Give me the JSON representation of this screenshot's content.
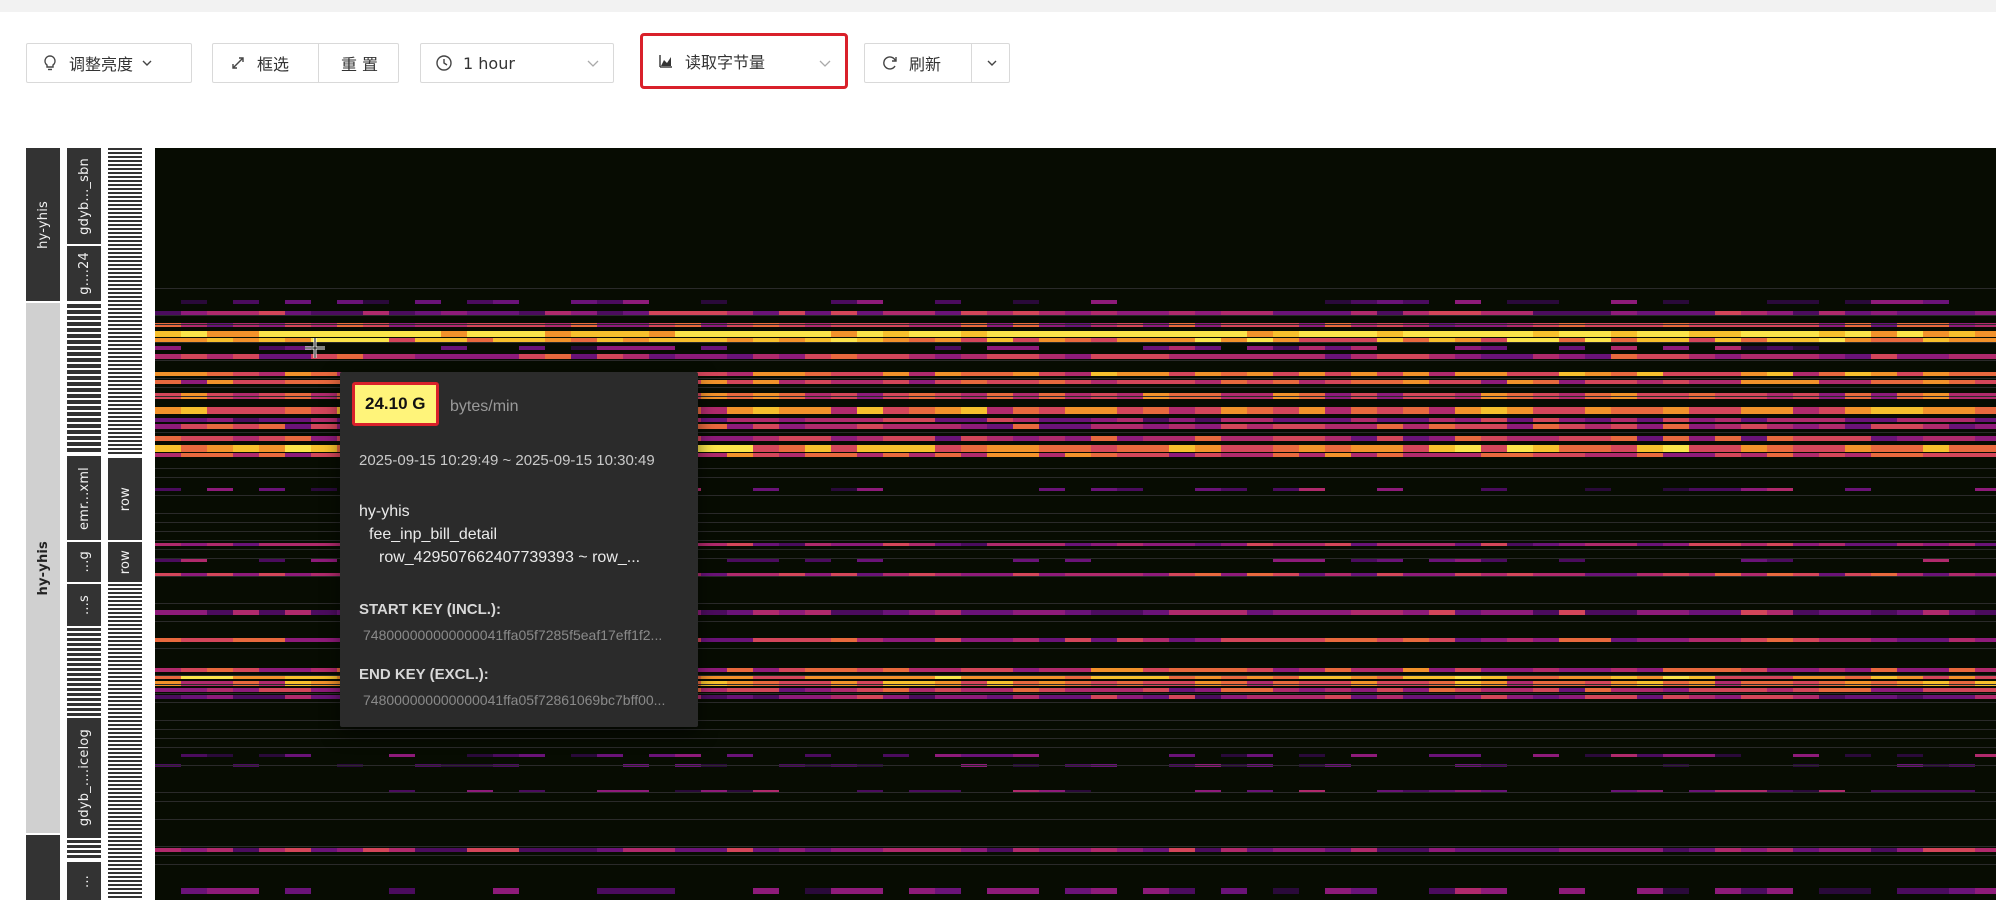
{
  "toolbar": {
    "brightness_label": "调整亮度",
    "select_label": "框选",
    "reset_label": "重 置",
    "time_range": "1 hour",
    "metric": "读取字节量",
    "refresh_label": "刷新"
  },
  "sidebar": {
    "col1": [
      "hy-yhis",
      "hy-yhis"
    ],
    "col2": [
      "gdyb..._sbn",
      "g....24",
      "emr...xml",
      "...g",
      "...s",
      "gdyb_....icelog",
      "..."
    ],
    "col3": [
      "row",
      "row"
    ]
  },
  "tooltip": {
    "value": "24.10 G",
    "unit": "bytes/min",
    "time": "2025-09-15 10:29:49 ~ 2025-09-15 10:30:49",
    "database": "hy-yhis",
    "table": "fee_inp_bill_detail",
    "range": "row_429507662407739393 ~ row_...",
    "start_key_label": "START KEY (INCL.):",
    "start_key": "748000000000000041ffa05f7285f5eaf17eff1f2...",
    "end_key_label": "END KEY (EXCL.):",
    "end_key": "748000000000000041ffa05f72861069bc7bff00..."
  },
  "colors": {
    "heatmap_bg": "#070c02",
    "highlight_border": "#d9202a",
    "tooltip_value_bg": "#fff47a"
  }
}
